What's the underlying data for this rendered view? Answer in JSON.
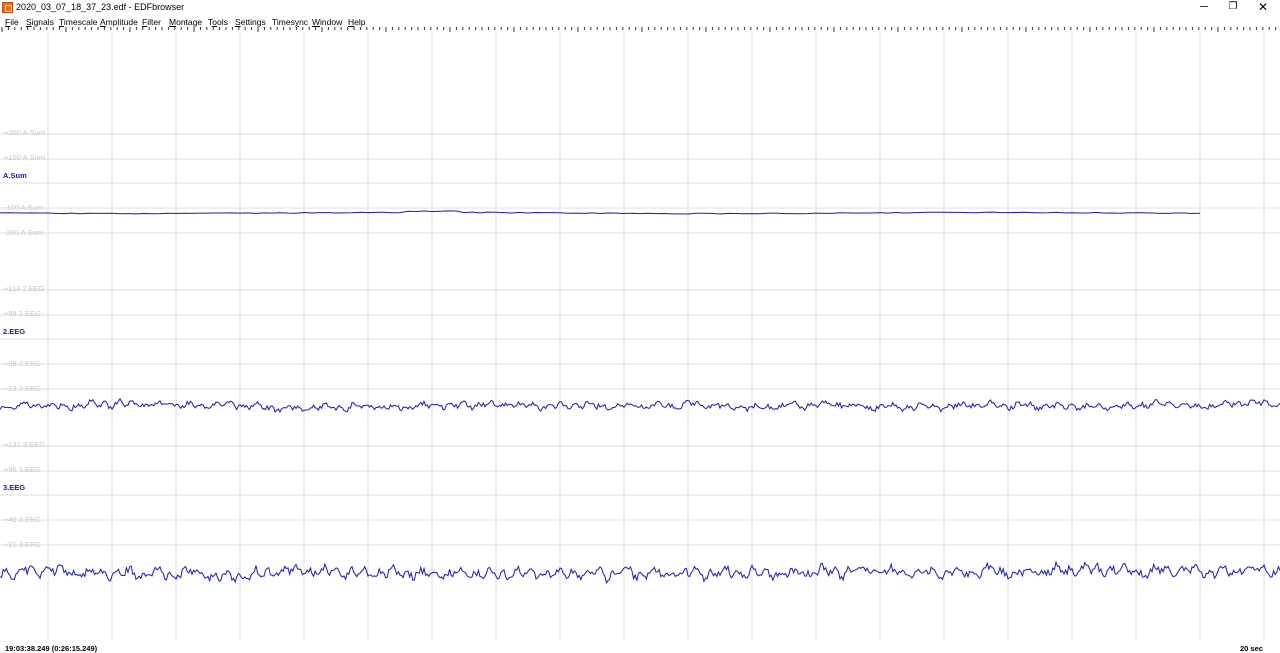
{
  "window": {
    "title": "2020_03_07_18_37_23.edf - EDFbrowser",
    "minimize_glyph": "─",
    "restore_glyph": "❐",
    "close_glyph": "✕"
  },
  "menu": [
    {
      "label": "File",
      "access_key": "F"
    },
    {
      "label": "Signals",
      "access_key": "S"
    },
    {
      "label": "Timescale",
      "access_key": "T"
    },
    {
      "label": "Amplitude",
      "access_key": "A"
    },
    {
      "label": "Filter",
      "access_key": "F"
    },
    {
      "label": "Montage",
      "access_key": "M"
    },
    {
      "label": "Tools",
      "access_key": "o"
    },
    {
      "label": "Settings",
      "access_key": "S"
    },
    {
      "label": "Timesync",
      "access_key": "y"
    },
    {
      "label": "Window",
      "access_key": "W"
    },
    {
      "label": "Help",
      "access_key": "H"
    }
  ],
  "signals": [
    {
      "name": "A.Sum",
      "scale_labels": [
        "+200 A.Sum",
        "+100 A.Sum",
        "-100 A.Sum",
        "-200 A.Sum"
      ],
      "trace_style": "flat"
    },
    {
      "name": "2.EEG",
      "scale_labels": [
        "+113 2.EEG",
        "+88 2.EEG",
        "+38 2.EEG",
        "+13 2.EEG"
      ],
      "trace_style": "noisy-low"
    },
    {
      "name": "3.EEG",
      "scale_labels": [
        "+121 3.EEG",
        "+96 3.EEG",
        "+46 3.EEG",
        "+21 3.EEG"
      ],
      "trace_style": "noisy-high"
    }
  ],
  "colors": {
    "trace": "#1a1ab4",
    "grid": "#dcdcdc",
    "scale_text": "#c8c8c8",
    "label": "#1a1aa8"
  },
  "status": {
    "time": "19:03:38.249 (0:26:15.249)",
    "duration": "20 sec"
  }
}
